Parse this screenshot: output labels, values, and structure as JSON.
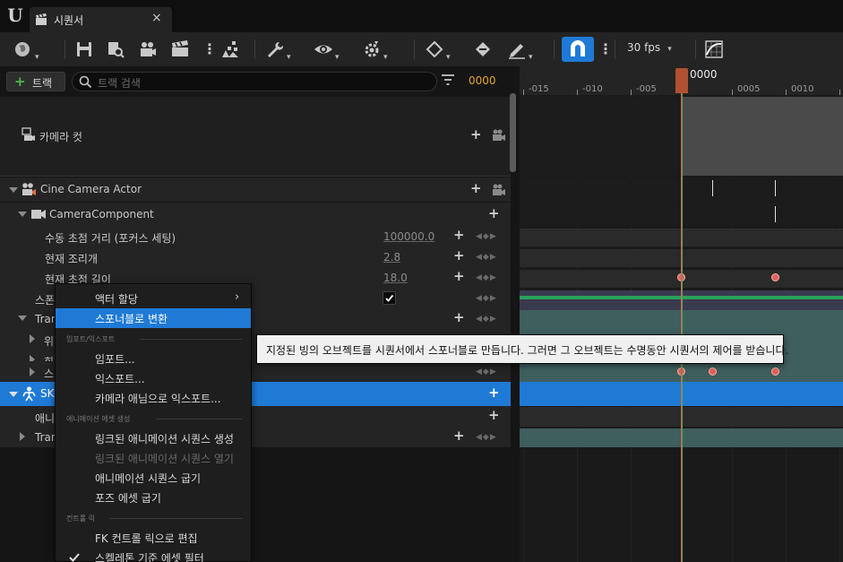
{
  "window": {
    "logo": "U",
    "tab_title": "시퀀서",
    "tab_close": "×",
    "tab_icon": "clapperboard-icon"
  },
  "toolbar": {
    "fps": "30 fps",
    "snap_color": "#1f7ad6",
    "icons": [
      "world-icon",
      "save-icon",
      "find-asset-icon",
      "camera-add-icon",
      "render-movie-icon",
      "more-icon",
      "actors-icon",
      "wrench-icon",
      "eye-icon",
      "gear-icon",
      "key-icon",
      "key-flag-icon",
      "pencil-icon",
      "snap-magnet-icon",
      "grid-curve-icon"
    ]
  },
  "outliner": {
    "add_track_label": "트랙",
    "search_placeholder": "트랙 검색",
    "frame": "0000",
    "frame_color": "#e6a32e",
    "rows": {
      "camera_cut": "카메라 컷",
      "cine_camera": "Cine Camera Actor",
      "camera_component": "CameraComponent",
      "manual_focus": "수동 초점 거리 (포커스 세팅)",
      "manual_focus_value": "100000.0",
      "aperture": "현재 조리개",
      "aperture_value": "2.8",
      "focal_length": "현재 초점 길이",
      "focal_length_value": "18.0",
      "spawned": "스폰",
      "transform1": "Tran",
      "location": "위",
      "rotation": "회",
      "scale": "스",
      "skeletal": "SK",
      "animation": "애니",
      "transform2": "Tran"
    }
  },
  "timeline": {
    "playhead": "0000",
    "ticks": [
      "-015",
      "-010",
      "-005",
      "0005",
      "0010"
    ]
  },
  "context_menu": {
    "items": {
      "assign_actor": "액터 할당",
      "convert_spawnable": "스포너블로 변환",
      "section_import": "임포트/익스포트",
      "import": "임포트...",
      "export": "익스포트...",
      "export_camera_anim": "카메라 애님으로 익스포트...",
      "section_anim": "애니메이션 에셋 생성",
      "create_linked_anim": "링크된 애니메이션 시퀀스 생성",
      "open_linked_anim": "링크된 애니메이션 시퀀스 열기",
      "bake_anim": "애니메이션 시퀀스 굽기",
      "bake_pose": "포즈 에셋 굽기",
      "section_rig": "컨트롤 릭",
      "edit_fk_rig": "FK 컨트롤 릭으로 편집",
      "skeleton_filter": "스켈레톤 기준 에셋 필터"
    }
  },
  "tooltip": "지정된 빙의 오브젝트를 시퀀서에서 스포너블로 만듭니다. 그러면 그 오브젝트는 수명동안 시퀀서의 제어를 받습니다."
}
